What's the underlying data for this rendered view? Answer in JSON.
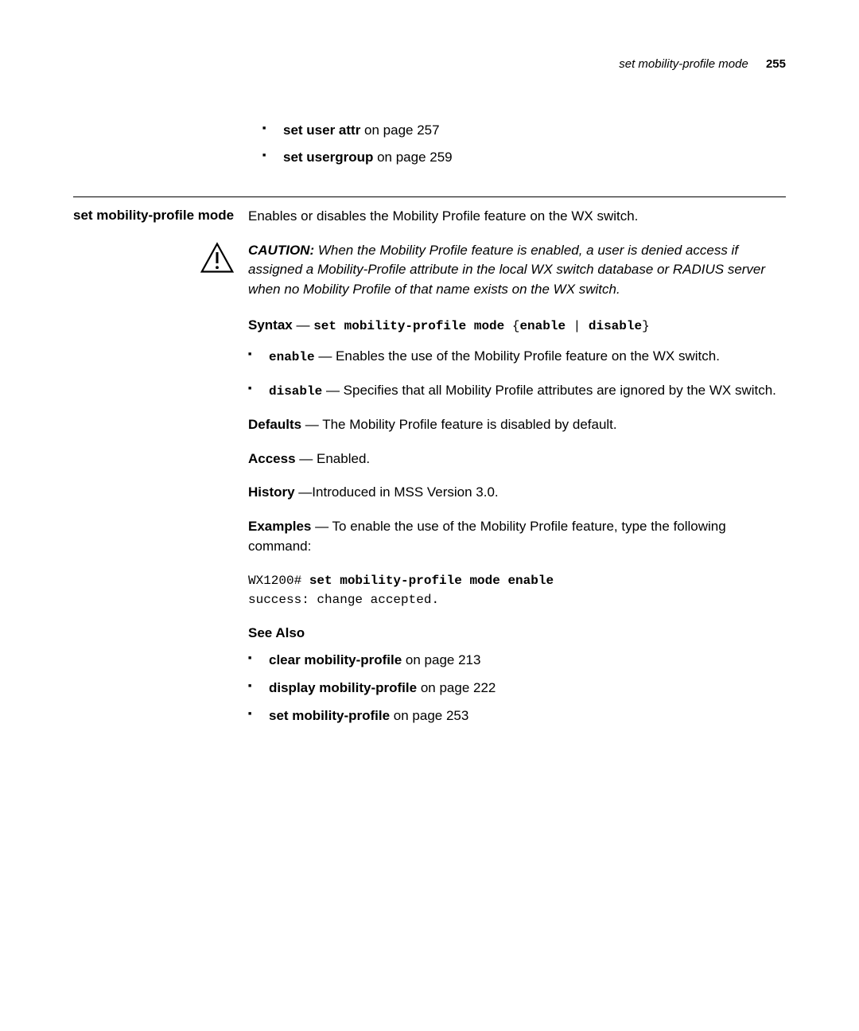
{
  "header": {
    "title": "set mobility-profile mode",
    "page": "255"
  },
  "top_refs": [
    {
      "bold": "set user attr",
      "rest": " on page 257"
    },
    {
      "bold": "set usergroup",
      "rest": " on page 259"
    }
  ],
  "section": {
    "heading": "set mobility-profile mode",
    "intro": "Enables or disables the Mobility Profile feature on the WX switch.",
    "caution_label": "CAUTION:",
    "caution_body": " When the Mobility Profile feature is enabled, a user is denied access if assigned a Mobility-Profile attribute in the local WX switch database or RADIUS server when no Mobility Profile of that name exists on the WX switch.",
    "syntax_label": "Syntax",
    "syntax_dash": " — ",
    "syntax_cmd_prefix": "set mobility-profile mode",
    "syntax_brace_open": " {",
    "syntax_opt1": "enable",
    "syntax_pipe": " | ",
    "syntax_opt2": "disable",
    "syntax_brace_close": "}",
    "options": [
      {
        "code": "enable",
        "rest": " — Enables the use of the Mobility Profile feature on the WX switch."
      },
      {
        "code": "disable",
        "rest": " — Specifies that all Mobility Profile attributes are ignored by the WX switch."
      }
    ],
    "defaults_label": "Defaults",
    "defaults_body": " — The Mobility Profile feature is disabled by default.",
    "access_label": "Access",
    "access_body": " — Enabled.",
    "history_label": "History",
    "history_body": " —Introduced in MSS Version 3.0.",
    "examples_label": "Examples",
    "examples_body": " — To enable the use of the Mobility Profile feature, type the following command:",
    "example_prompt": "WX1200# ",
    "example_cmd": "set mobility-profile mode enable",
    "example_output": "success: change accepted.",
    "see_also_heading": "See Also",
    "see_also": [
      {
        "bold": "clear mobility-profile",
        "rest": " on page 213"
      },
      {
        "bold": "display mobility-profile",
        "rest": " on page 222"
      },
      {
        "bold": "set mobility-profile",
        "rest": " on page 253"
      }
    ]
  }
}
